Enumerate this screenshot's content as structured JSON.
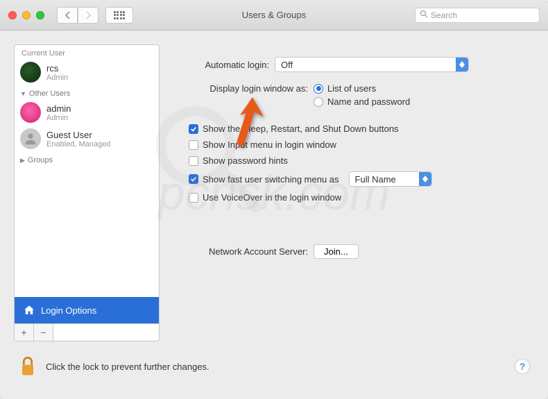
{
  "window": {
    "title": "Users & Groups",
    "search_placeholder": "Search"
  },
  "sidebar": {
    "current_user_label": "Current User",
    "current_user": {
      "name": "rcs",
      "role": "Admin"
    },
    "other_users_label": "Other Users",
    "other_users": [
      {
        "name": "admin",
        "role": "Admin"
      },
      {
        "name": "Guest User",
        "role": "Enabled, Managed"
      }
    ],
    "groups_label": "Groups",
    "login_options_label": "Login Options"
  },
  "settings": {
    "auto_login_label": "Automatic login:",
    "auto_login_value": "Off",
    "display_as_label": "Display login window as:",
    "display_options": {
      "list": "List of users",
      "namepwd": "Name and password"
    },
    "checkboxes": {
      "sleep_restart": "Show the Sleep, Restart, and Shut Down buttons",
      "input_menu": "Show Input menu in login window",
      "password_hints": "Show password hints",
      "fast_switch": "Show fast user switching menu as",
      "voiceover": "Use VoiceOver in the login window"
    },
    "fast_switch_value": "Full Name",
    "network_label": "Network Account Server:",
    "join_label": "Join..."
  },
  "footer": {
    "lock_text": "Click the lock to prevent further changes."
  },
  "watermark": "pcrisk.com"
}
